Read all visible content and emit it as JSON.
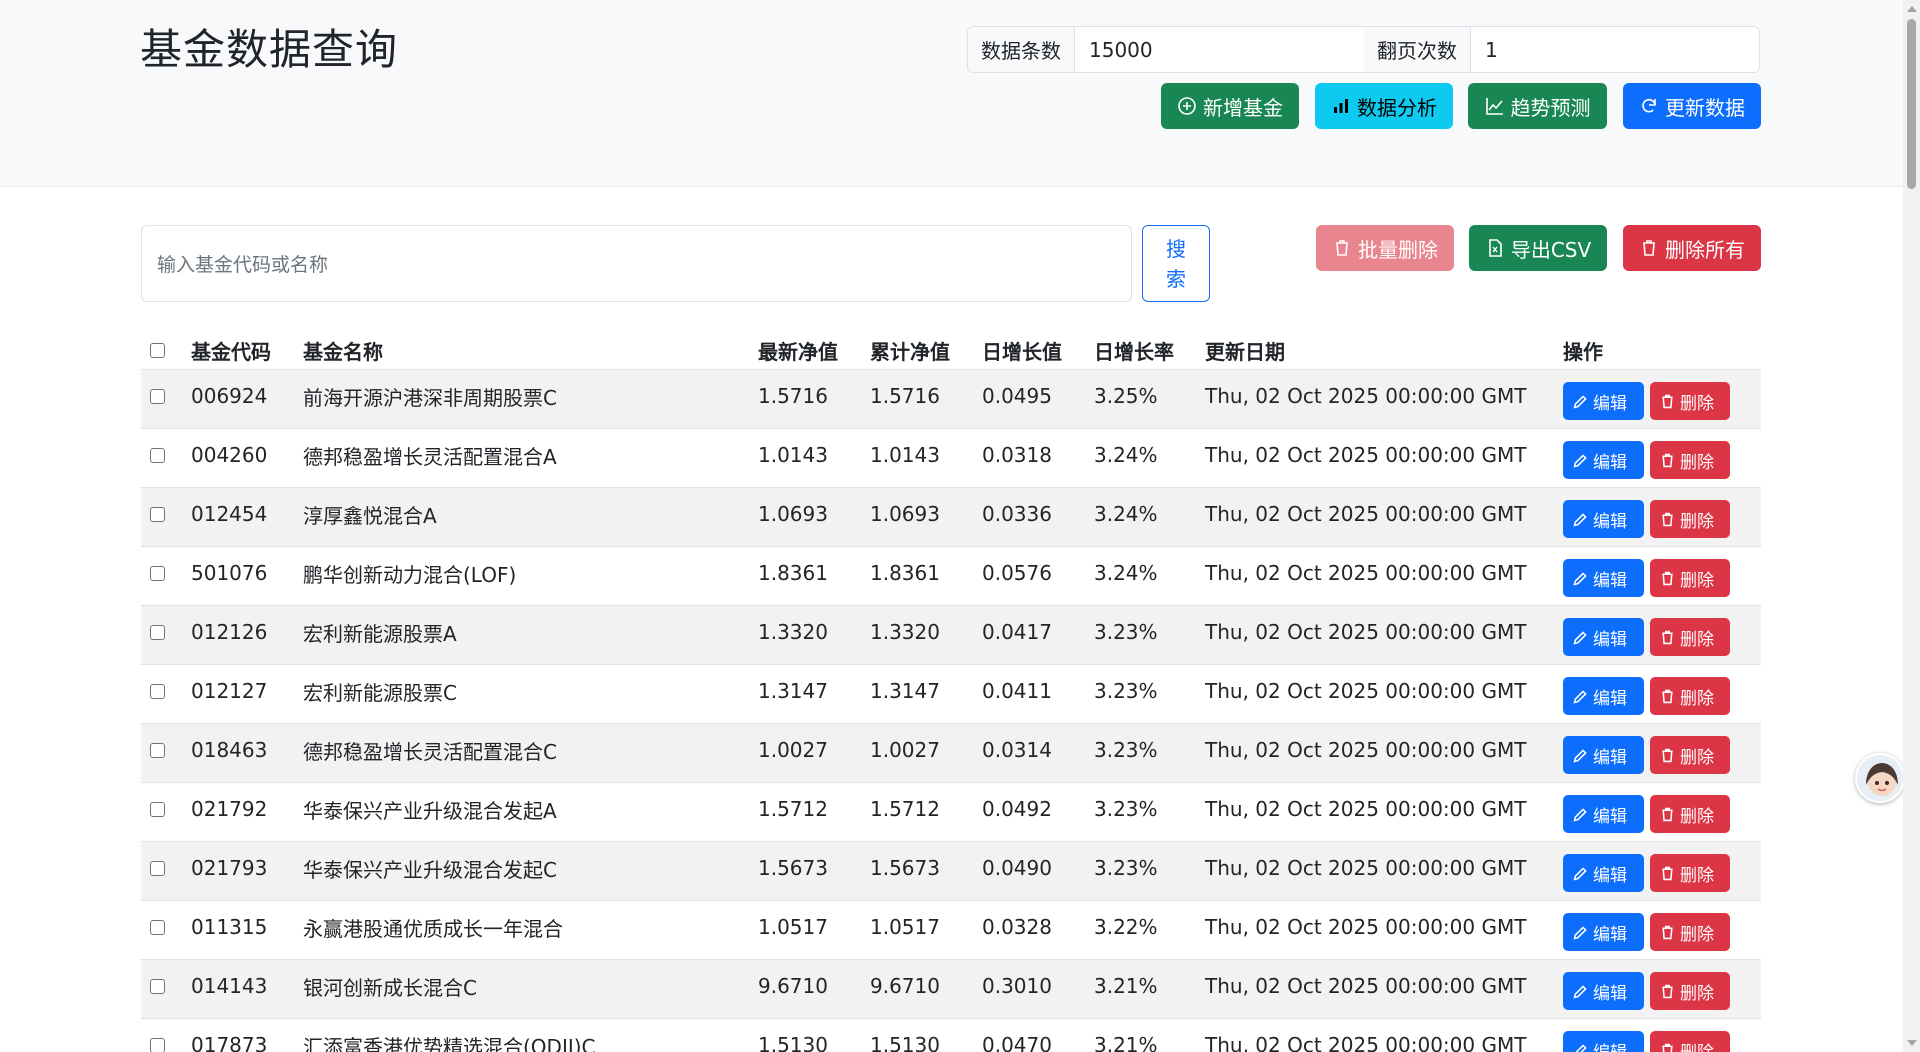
{
  "header": {
    "title": "基金数据查询",
    "params": {
      "count_label": "数据条数",
      "count_value": "15000",
      "page_label": "翻页次数",
      "page_value": "1"
    },
    "actions": {
      "add_label": "新增基金",
      "analysis_label": "数据分析",
      "forecast_label": "趋势预测",
      "refresh_label": "更新数据"
    }
  },
  "search": {
    "placeholder": "输入基金代码或名称",
    "button_label": "搜索",
    "batch_delete_label": "批量删除",
    "export_label": "导出CSV",
    "delete_all_label": "删除所有"
  },
  "table": {
    "headers": {
      "code": "基金代码",
      "name": "基金名称",
      "nav": "最新净值",
      "acc": "累计净值",
      "inc": "日增长值",
      "rate": "日增长率",
      "date": "更新日期",
      "ops": "操作"
    },
    "edit_label": "编辑",
    "delete_label": "删除",
    "rows": [
      {
        "code": "006924",
        "name": "前海开源沪港深非周期股票C",
        "nav": "1.5716",
        "acc": "1.5716",
        "inc": "0.0495",
        "rate": "3.25%",
        "date": "Thu, 02 Oct 2025 00:00:00 GMT"
      },
      {
        "code": "004260",
        "name": "德邦稳盈增长灵活配置混合A",
        "nav": "1.0143",
        "acc": "1.0143",
        "inc": "0.0318",
        "rate": "3.24%",
        "date": "Thu, 02 Oct 2025 00:00:00 GMT"
      },
      {
        "code": "012454",
        "name": "淳厚鑫悦混合A",
        "nav": "1.0693",
        "acc": "1.0693",
        "inc": "0.0336",
        "rate": "3.24%",
        "date": "Thu, 02 Oct 2025 00:00:00 GMT"
      },
      {
        "code": "501076",
        "name": "鹏华创新动力混合(LOF)",
        "nav": "1.8361",
        "acc": "1.8361",
        "inc": "0.0576",
        "rate": "3.24%",
        "date": "Thu, 02 Oct 2025 00:00:00 GMT"
      },
      {
        "code": "012126",
        "name": "宏利新能源股票A",
        "nav": "1.3320",
        "acc": "1.3320",
        "inc": "0.0417",
        "rate": "3.23%",
        "date": "Thu, 02 Oct 2025 00:00:00 GMT"
      },
      {
        "code": "012127",
        "name": "宏利新能源股票C",
        "nav": "1.3147",
        "acc": "1.3147",
        "inc": "0.0411",
        "rate": "3.23%",
        "date": "Thu, 02 Oct 2025 00:00:00 GMT"
      },
      {
        "code": "018463",
        "name": "德邦稳盈增长灵活配置混合C",
        "nav": "1.0027",
        "acc": "1.0027",
        "inc": "0.0314",
        "rate": "3.23%",
        "date": "Thu, 02 Oct 2025 00:00:00 GMT"
      },
      {
        "code": "021792",
        "name": "华泰保兴产业升级混合发起A",
        "nav": "1.5712",
        "acc": "1.5712",
        "inc": "0.0492",
        "rate": "3.23%",
        "date": "Thu, 02 Oct 2025 00:00:00 GMT"
      },
      {
        "code": "021793",
        "name": "华泰保兴产业升级混合发起C",
        "nav": "1.5673",
        "acc": "1.5673",
        "inc": "0.0490",
        "rate": "3.23%",
        "date": "Thu, 02 Oct 2025 00:00:00 GMT"
      },
      {
        "code": "011315",
        "name": "永赢港股通优质成长一年混合",
        "nav": "1.0517",
        "acc": "1.0517",
        "inc": "0.0328",
        "rate": "3.22%",
        "date": "Thu, 02 Oct 2025 00:00:00 GMT"
      },
      {
        "code": "014143",
        "name": "银河创新成长混合C",
        "nav": "9.6710",
        "acc": "9.6710",
        "inc": "0.3010",
        "rate": "3.21%",
        "date": "Thu, 02 Oct 2025 00:00:00 GMT"
      },
      {
        "code": "017873",
        "name": "汇添富香港优势精选混合(QDII)C",
        "nav": "1.5130",
        "acc": "1.5130",
        "inc": "0.0470",
        "rate": "3.21%",
        "date": "Thu, 02 Oct 2025 00:00:00 GMT"
      }
    ]
  },
  "icons": {
    "add": "plus-circle-icon",
    "analysis": "bar-chart-icon",
    "forecast": "line-chart-icon",
    "refresh": "refresh-icon",
    "trash": "trash-icon",
    "export": "file-excel-icon",
    "edit": "pencil-icon"
  },
  "colors": {
    "primary": "#0d6efd",
    "success": "#198754",
    "info": "#0dcaf0",
    "danger": "#dc3545"
  }
}
